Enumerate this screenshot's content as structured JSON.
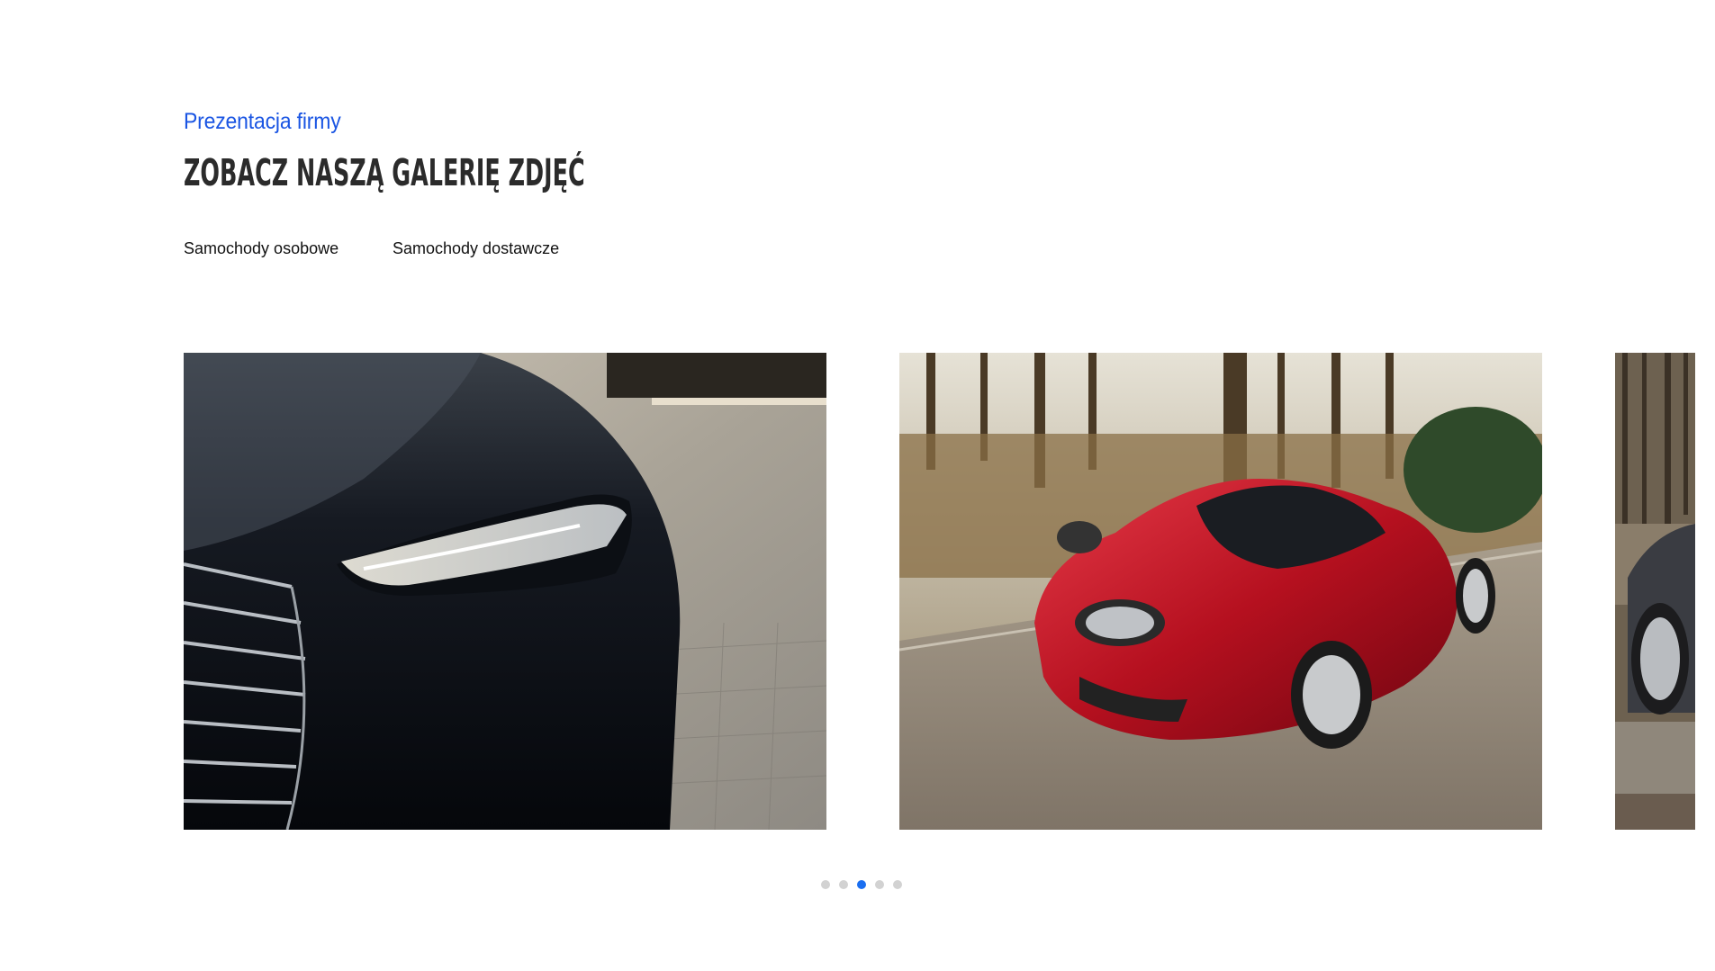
{
  "section": {
    "subtitle": "Prezentacja firmy",
    "title": "Zobacz naszą galerię zdjęć"
  },
  "tabs": [
    {
      "label": "Samochody osobowe"
    },
    {
      "label": "Samochody dostawcze"
    }
  ],
  "gallery": {
    "slides": [
      {
        "image": "black-car-headlight-photo"
      },
      {
        "image": "red-sports-car-photo"
      },
      {
        "image": "dark-car-partial-photo"
      }
    ],
    "pagination": {
      "total": 5,
      "active": 3
    }
  },
  "colors": {
    "accent": "#1a55e3",
    "title": "#2b2b2b",
    "dot": "#d2d2d2",
    "dot_active": "#1a6ef0"
  }
}
